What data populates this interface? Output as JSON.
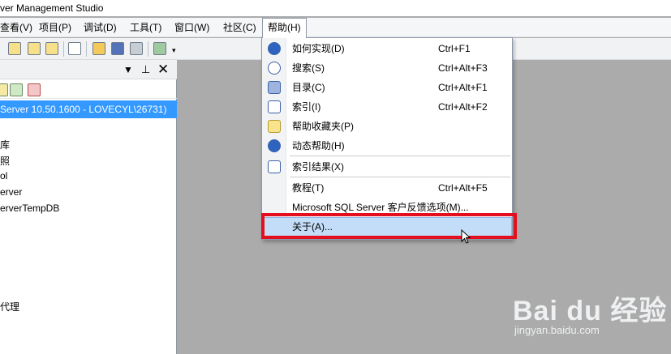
{
  "window": {
    "title": "ver Management Studio"
  },
  "menubar": {
    "items": [
      {
        "label": "查看(V)"
      },
      {
        "label": "项目(P)"
      },
      {
        "label": "调试(D)"
      },
      {
        "label": "工具(T)"
      },
      {
        "label": "窗口(W)"
      },
      {
        "label": "社区(C)"
      },
      {
        "label": "帮助(H)",
        "open": true
      }
    ]
  },
  "toolbar": {
    "icons": [
      "new-query-icon",
      "database-engine-query-icon",
      "analysis-query-icon",
      "mdx-query-icon",
      "new-file-icon",
      "open-file-icon",
      "save-icon",
      "print-icon",
      "activity-monitor-icon",
      "overflow-chevron-icon"
    ]
  },
  "object_explorer": {
    "header_icons": [
      "dropdown-arrow-icon",
      "pin-icon",
      "close-icon"
    ],
    "toolbar_icons": [
      "filter-icon",
      "refresh-icon",
      "stop-icon"
    ],
    "selected_node": "Server 10.50.1600 - LOVECYL\\26731)",
    "nodes": [
      "库",
      "照",
      "ol",
      "erver",
      "erverTempDB",
      "代理"
    ]
  },
  "help_menu": {
    "items": [
      {
        "label": "如何实现(D)",
        "shortcut": "Ctrl+F1",
        "icon": "how-do-i-icon"
      },
      {
        "label": "搜索(S)",
        "shortcut": "Ctrl+Alt+F3",
        "icon": "search-icon"
      },
      {
        "label": "目录(C)",
        "shortcut": "Ctrl+Alt+F1",
        "icon": "contents-icon"
      },
      {
        "label": "索引(I)",
        "shortcut": "Ctrl+Alt+F2",
        "icon": "index-icon"
      },
      {
        "label": "帮助收藏夹(P)",
        "shortcut": "",
        "icon": "favorites-icon"
      },
      {
        "label": "动态帮助(H)",
        "shortcut": "",
        "icon": "dynamic-help-icon"
      },
      {
        "label": "索引结果(X)",
        "shortcut": "",
        "icon": "index-results-icon"
      },
      {
        "label": "教程(T)",
        "shortcut": "Ctrl+Alt+F5",
        "icon": ""
      },
      {
        "label": "Microsoft SQL Server 客户反馈选项(M)...",
        "shortcut": "",
        "icon": ""
      },
      {
        "label": "关于(A)...",
        "shortcut": "",
        "icon": "",
        "highlighted": true
      }
    ]
  },
  "annotation": {
    "color": "#e30e1e"
  },
  "watermark": {
    "logo": "Bai du 经验",
    "url": "jingyan.baidu.com"
  },
  "colors": {
    "selection": "#3399ff",
    "menu_highlight": "#c3dcf7",
    "workspace": "#ababab"
  }
}
